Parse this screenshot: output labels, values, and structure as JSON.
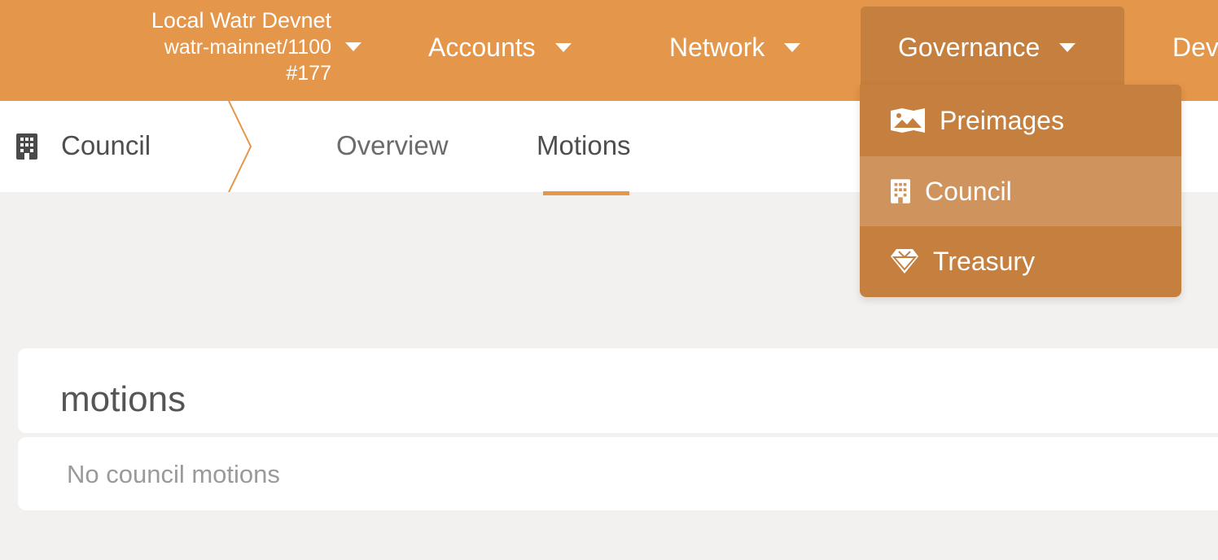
{
  "chain": {
    "name": "Local Watr Devnet",
    "spec": "watr-mainnet/1100",
    "block": "#177"
  },
  "nav": {
    "accounts": "Accounts",
    "network": "Network",
    "governance": "Governance",
    "developer_partial": "Dev"
  },
  "governance_menu": {
    "items": [
      {
        "label": "Preimages",
        "icon": "image-icon"
      },
      {
        "label": "Council",
        "icon": "building-icon"
      },
      {
        "label": "Treasury",
        "icon": "gem-icon"
      }
    ],
    "selected": "Council"
  },
  "section": {
    "title": "Council",
    "tabs": [
      "Overview",
      "Motions"
    ],
    "active_tab": "Motions"
  },
  "motions": {
    "heading": "motions",
    "empty_text": "No council motions"
  },
  "colors": {
    "brand": "#e4964a",
    "menu_active": "#c57f3e",
    "menu_selected": "#cf935e"
  }
}
